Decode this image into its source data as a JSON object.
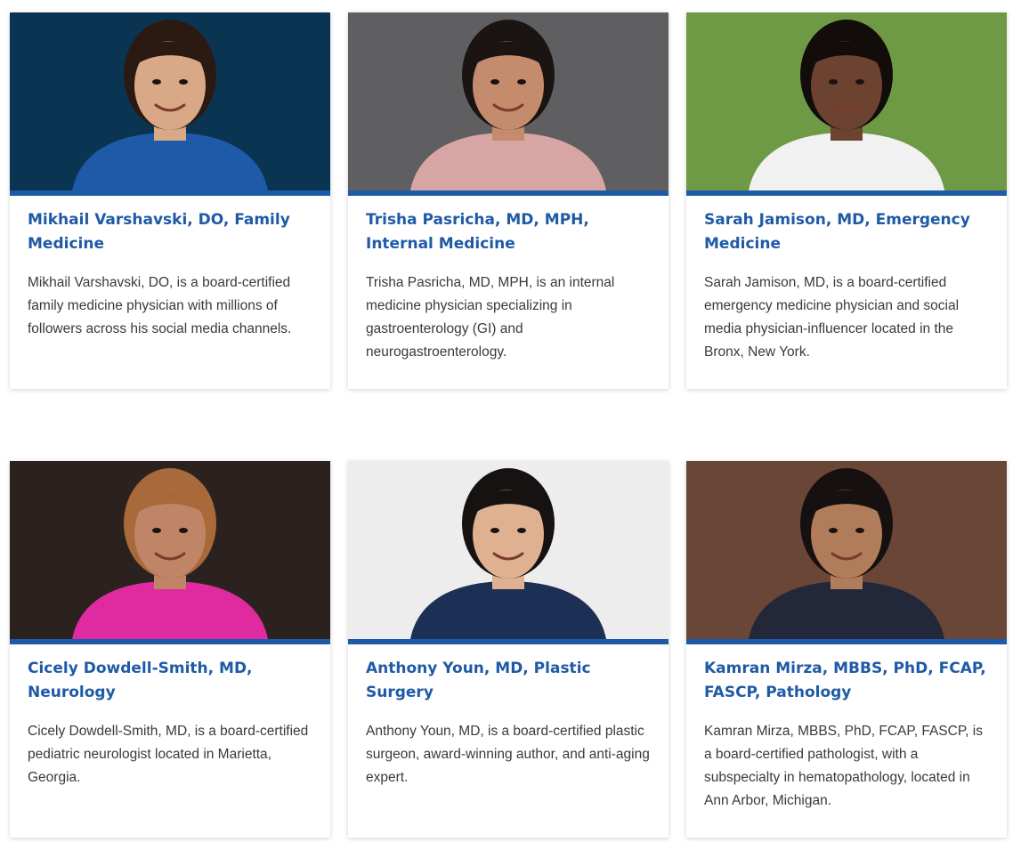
{
  "doctors": [
    {
      "name": "Mikhail Varshavski, DO, Family Medicine",
      "description": "Mikhail Varshavski, DO, is a board-certified family medicine physician with millions of followers across his social media channels.",
      "photo": {
        "bg": "#0a3552",
        "skin": "#d9a887",
        "hair": "#2a1a12",
        "clothes": "#1e5aa8"
      }
    },
    {
      "name": "Trisha Pasricha, MD, MPH, Internal Medicine",
      "description": "Trisha Pasricha, MD, MPH, is an internal medicine physician specializing in gastroenterology (GI) and neurogastroenterology.",
      "photo": {
        "bg": "#5f5f61",
        "skin": "#c48c6c",
        "hair": "#1a1412",
        "clothes": "#d8a5a5"
      }
    },
    {
      "name": "Sarah Jamison, MD, Emergency Medicine",
      "description": "Sarah Jamison, MD, is a board-certified emergency medicine physician and social media physician-influencer located in the Bronx, New York.",
      "photo": {
        "bg": "#6e9a45",
        "skin": "#6b4330",
        "hair": "#120c0a",
        "clothes": "#f1f1f1"
      }
    },
    {
      "name": "Cicely Dowdell-Smith, MD, Neurology",
      "description": "Cicely Dowdell-Smith, MD, is a board-certified pediatric neurologist located in Marietta, Georgia.",
      "photo": {
        "bg": "#2b2220",
        "skin": "#c08566",
        "hair": "#a86a3a",
        "clothes": "#e02aa0"
      }
    },
    {
      "name": "Anthony Youn, MD, Plastic Surgery",
      "description": "Anthony Youn, MD, is a board-certified plastic surgeon, award-winning author, and anti-aging expert.",
      "photo": {
        "bg": "#ededed",
        "skin": "#e0b190",
        "hair": "#161212",
        "clothes": "#1c2f55"
      }
    },
    {
      "name": "Kamran Mirza, MBBS, PhD, FCAP, FASCP, Pathology",
      "description": "Kamran Mirza, MBBS, PhD, FCAP, FASCP, is a board-certified pathologist, with a subspecialty in hematopathology, located in Ann Arbor, Michigan.",
      "photo": {
        "bg": "#6a4636",
        "skin": "#b17c5a",
        "hair": "#161110",
        "clothes": "#22283a"
      }
    }
  ]
}
